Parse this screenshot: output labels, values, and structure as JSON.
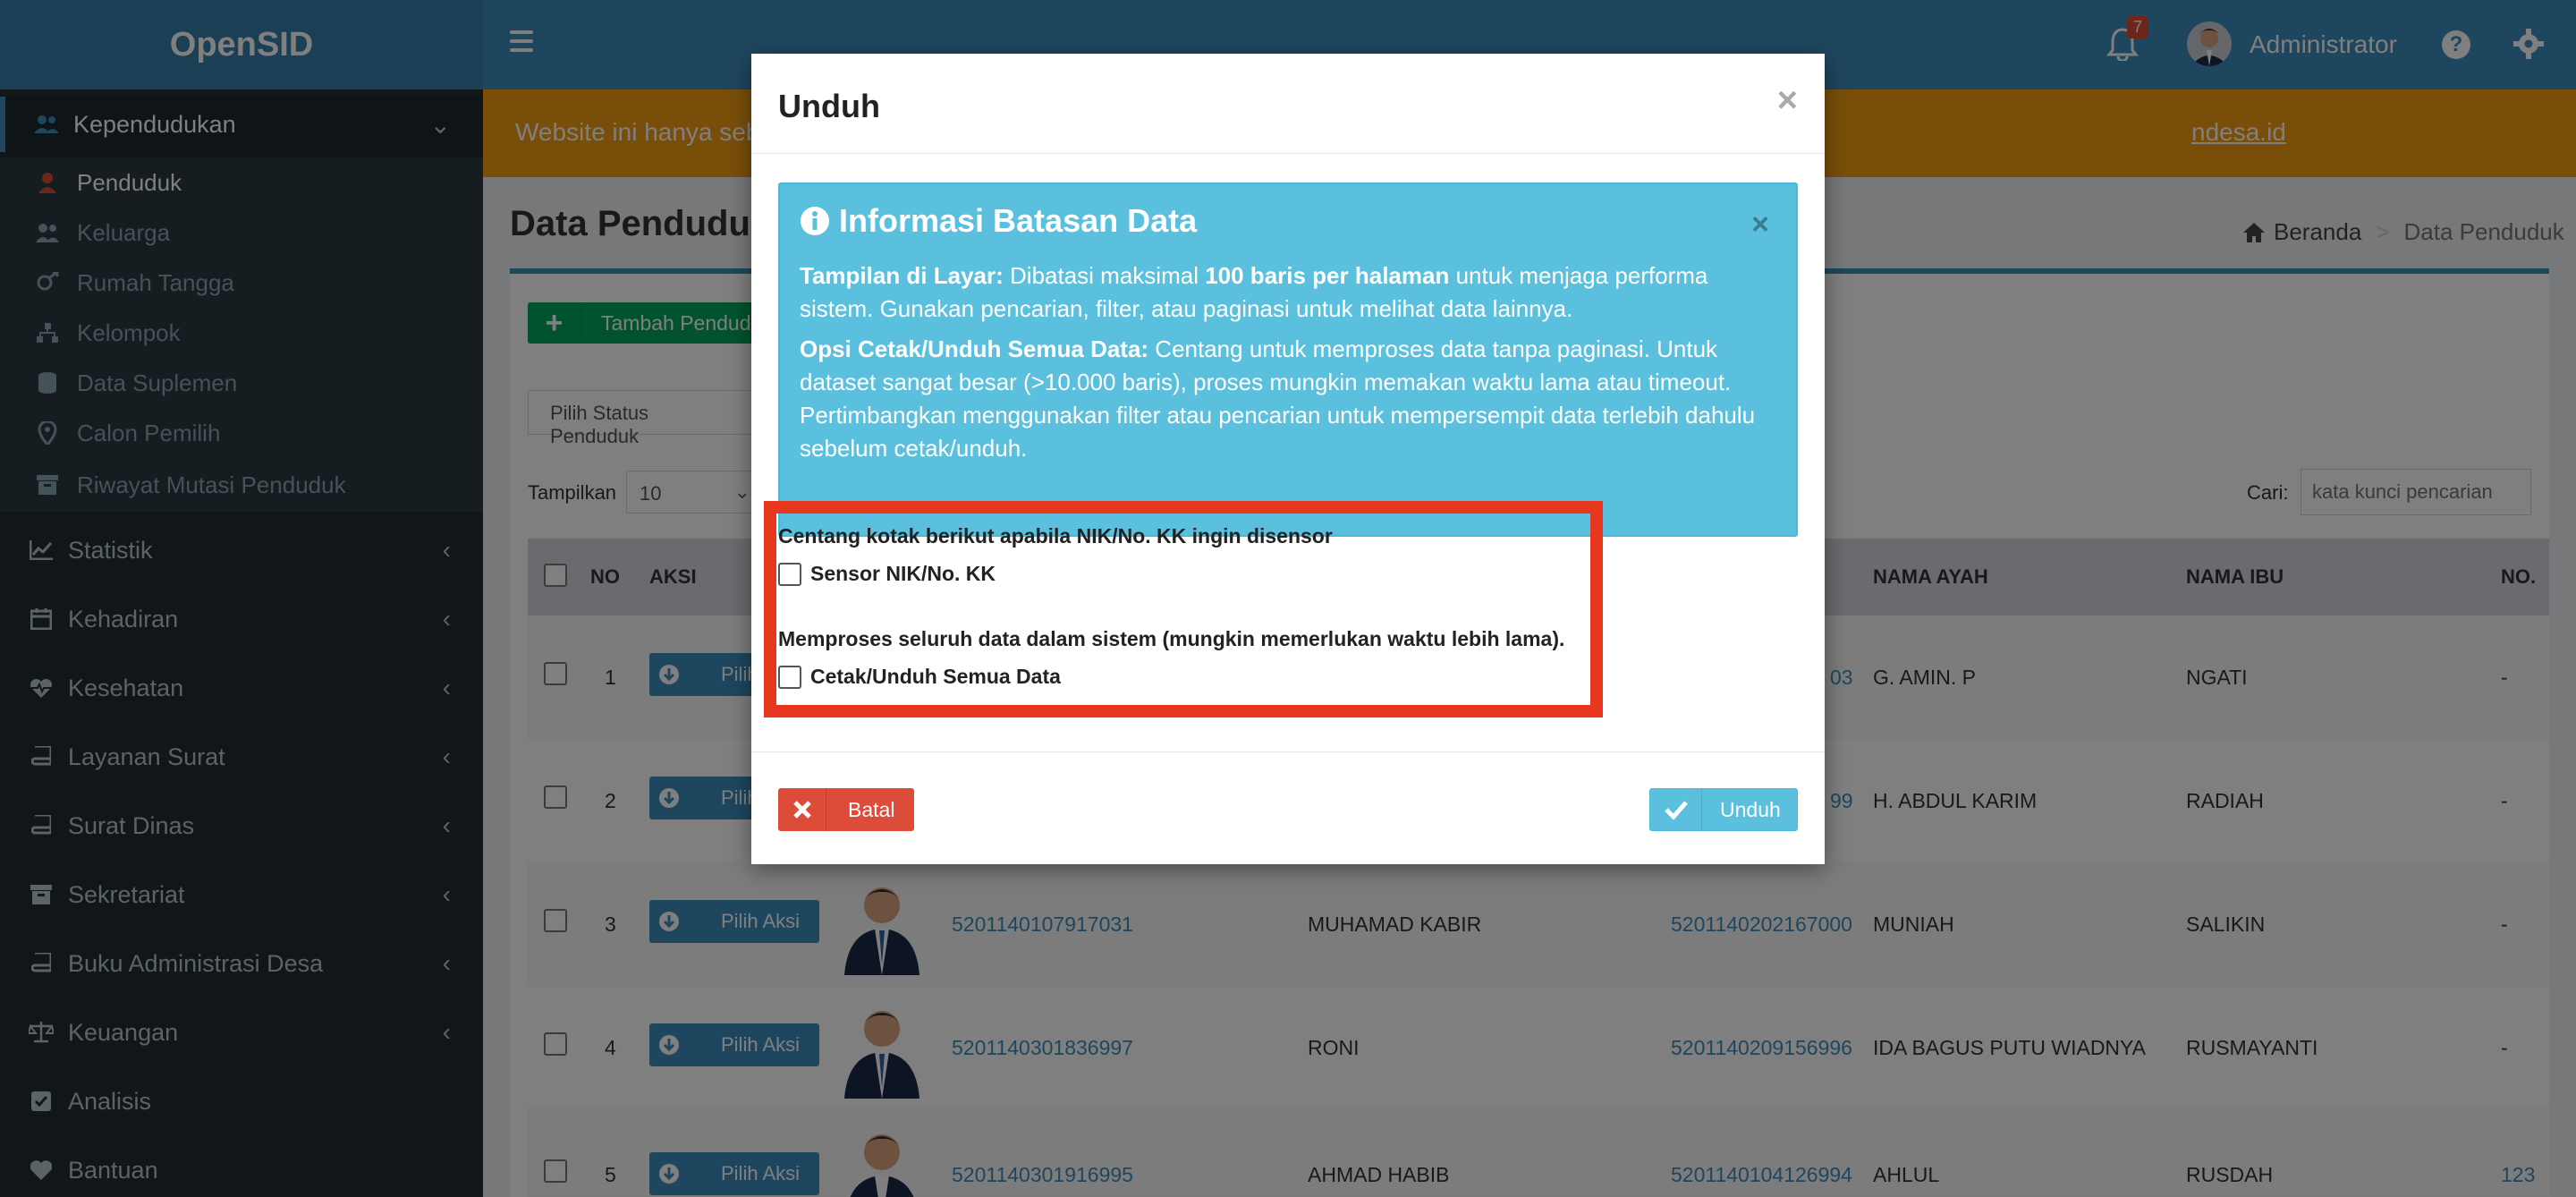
{
  "app": {
    "logo": "OpenSID"
  },
  "header": {
    "notification_count": "7",
    "user_name": "Administrator",
    "help_label": "?"
  },
  "sidebar": {
    "kependudukan": {
      "label": "Kependudukan",
      "icon": "users-icon"
    },
    "sub_items": [
      {
        "label": "Penduduk",
        "icon": "user-icon"
      },
      {
        "label": "Keluarga",
        "icon": "users-icon"
      },
      {
        "label": "Rumah Tangga",
        "icon": "venus-mars-icon"
      },
      {
        "label": "Kelompok",
        "icon": "sitemap-icon"
      },
      {
        "label": "Data Suplemen",
        "icon": "database-icon"
      },
      {
        "label": "Calon Pemilih",
        "icon": "location-icon"
      },
      {
        "label": "Riwayat Mutasi Penduduk",
        "icon": "archive-icon"
      }
    ],
    "items": [
      {
        "label": "Statistik",
        "icon": "line-chart-icon"
      },
      {
        "label": "Kehadiran",
        "icon": "calendar-icon"
      },
      {
        "label": "Kesehatan",
        "icon": "heartbeat-icon"
      },
      {
        "label": "Layanan Surat",
        "icon": "book-icon"
      },
      {
        "label": "Surat Dinas",
        "icon": "book-icon"
      },
      {
        "label": "Sekretariat",
        "icon": "archive-icon"
      },
      {
        "label": "Buku Administrasi Desa",
        "icon": "book-icon"
      },
      {
        "label": "Keuangan",
        "icon": "balance-scale-icon"
      },
      {
        "label": "Analisis",
        "icon": "check-square-icon"
      },
      {
        "label": "Bantuan",
        "icon": "heart-icon"
      }
    ]
  },
  "notice": {
    "text": "Website ini hanya seba",
    "link": "ndesa.id"
  },
  "page": {
    "title": "Data Penduduk",
    "breadcrumb": {
      "home": "Beranda",
      "current": "Data Penduduk"
    },
    "add_button": "Tambah Pendudu",
    "status_select": "Pilih Status Penduduk",
    "show_label": "Tampilkan",
    "show_value": "10",
    "search_label": "Cari:",
    "search_placeholder": "kata kunci pencarian"
  },
  "table": {
    "headers": {
      "no": "NO",
      "aksi": "AKSI",
      "ayah": "NAMA AYAH",
      "ibu": "NAMA IBU",
      "nokk": "NO."
    },
    "action_label": "Pilih Aksi",
    "rows": [
      {
        "no": "1",
        "nik": "",
        "nama": "",
        "nokk": "03",
        "ayah": "G. AMIN. P",
        "ibu": "NGATI",
        "last": "-"
      },
      {
        "no": "2",
        "nik": "",
        "nama": "",
        "nokk": "99",
        "ayah": "H. ABDUL KARIM",
        "ibu": "RADIAH",
        "last": "-"
      },
      {
        "no": "3",
        "nik": "5201140107917031",
        "nama": "MUHAMAD KABIR",
        "nokk": "5201140202167000",
        "ayah": "MUNIAH",
        "ibu": "SALIKIN",
        "last": "-"
      },
      {
        "no": "4",
        "nik": "5201140301836997",
        "nama": "RONI",
        "nokk": "5201140209156996",
        "ayah": "IDA BAGUS PUTU WIADNYA",
        "ibu": "RUSMAYANTI",
        "last": "-"
      },
      {
        "no": "5",
        "nik": "5201140301916995",
        "nama": "AHMAD HABIB",
        "nokk": "5201140104126994",
        "ayah": "AHLUL",
        "ibu": "RUSDAH",
        "last": "123"
      }
    ]
  },
  "modal": {
    "title": "Unduh",
    "close": "×",
    "info": {
      "title": "Informasi Batasan Data",
      "close": "×",
      "p1_bold": "Tampilan di Layar:",
      "p1_a": " Dibatasi maksimal ",
      "p1_bold2": "100 baris per halaman",
      "p1_b": " untuk menjaga performa sistem. Gunakan pencarian, filter, atau paginasi untuk melihat data lainnya.",
      "p2_bold": "Opsi Cetak/Unduh Semua Data:",
      "p2_text": " Centang untuk memproses data tanpa paginasi. Untuk dataset sangat besar (>10.000 baris), proses mungkin memakan waktu lama atau timeout. Pertimbangkan menggunakan filter atau pencarian untuk mempersempit data terlebih dahulu sebelum cetak/unduh."
    },
    "opt1_title": "Centang kotak berikut apabila NIK/No. KK ingin disensor",
    "opt1_label": "Sensor NIK/No. KK",
    "opt2_title": "Memproses seluruh data dalam sistem (mungkin memerlukan waktu lebih lama).",
    "opt2_label": "Cetak/Unduh Semua Data",
    "cancel": "Batal",
    "download": "Unduh"
  },
  "colors": {
    "header": "#3c8dbc",
    "sidebar": "#222d32",
    "info": "#5bc0de",
    "danger": "#dd4b39",
    "highlight": "#e8371f",
    "notice": "#f39c12"
  }
}
